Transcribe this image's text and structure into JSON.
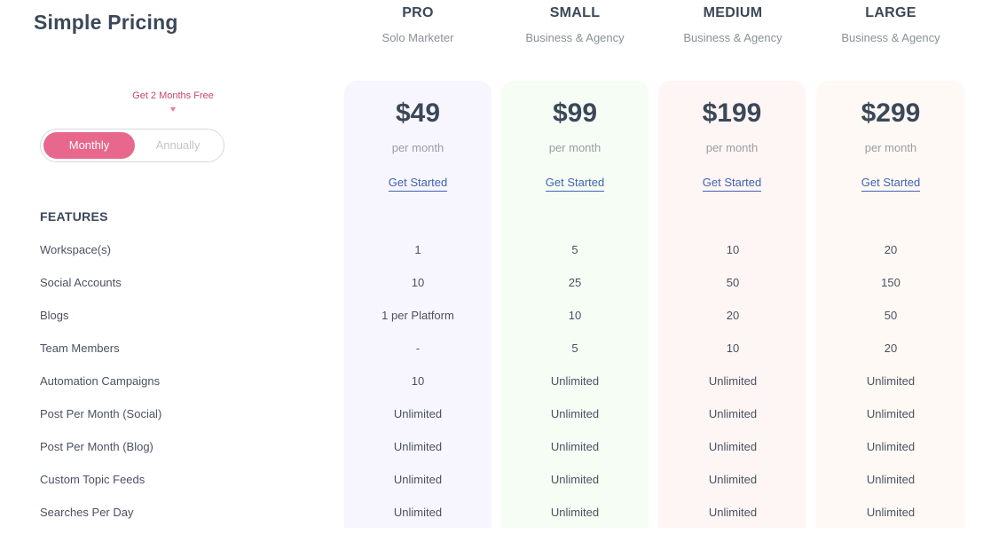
{
  "header": {
    "title": "Simple Pricing"
  },
  "billing": {
    "promo": "Get 2 Months Free",
    "options": [
      "Monthly",
      "Annually"
    ],
    "selected": "Monthly"
  },
  "colors": {
    "accent": "#e8678d",
    "link": "#3f63b0",
    "card_pro": "#f7f6fe",
    "card_small": "#f6fdf5",
    "card_medium": "#fef5f5",
    "card_large": "#fef9f5"
  },
  "plans": [
    {
      "name": "PRO",
      "subtitle": "Solo Marketer",
      "price": "$49",
      "period": "per month",
      "cta": "Get Started"
    },
    {
      "name": "SMALL",
      "subtitle": "Business & Agency",
      "price": "$99",
      "period": "per month",
      "cta": "Get Started"
    },
    {
      "name": "MEDIUM",
      "subtitle": "Business & Agency",
      "price": "$199",
      "period": "per month",
      "cta": "Get Started"
    },
    {
      "name": "LARGE",
      "subtitle": "Business & Agency",
      "price": "$299",
      "period": "per month",
      "cta": "Get Started"
    }
  ],
  "features": {
    "title": "FEATURES",
    "rows": [
      {
        "label": "Workspace(s)",
        "values": [
          "1",
          "5",
          "10",
          "20"
        ]
      },
      {
        "label": "Social Accounts",
        "values": [
          "10",
          "25",
          "50",
          "150"
        ]
      },
      {
        "label": "Blogs",
        "values": [
          "1 per Platform",
          "10",
          "20",
          "50"
        ]
      },
      {
        "label": "Team Members",
        "values": [
          "-",
          "5",
          "10",
          "20"
        ]
      },
      {
        "label": "Automation Campaigns",
        "values": [
          "10",
          "Unlimited",
          "Unlimited",
          "Unlimited"
        ]
      },
      {
        "label": "Post Per Month (Social)",
        "values": [
          "Unlimited",
          "Unlimited",
          "Unlimited",
          "Unlimited"
        ]
      },
      {
        "label": "Post Per Month (Blog)",
        "values": [
          "Unlimited",
          "Unlimited",
          "Unlimited",
          "Unlimited"
        ]
      },
      {
        "label": "Custom Topic Feeds",
        "values": [
          "Unlimited",
          "Unlimited",
          "Unlimited",
          "Unlimited"
        ]
      },
      {
        "label": "Searches Per Day",
        "values": [
          "Unlimited",
          "Unlimited",
          "Unlimited",
          "Unlimited"
        ]
      }
    ]
  }
}
